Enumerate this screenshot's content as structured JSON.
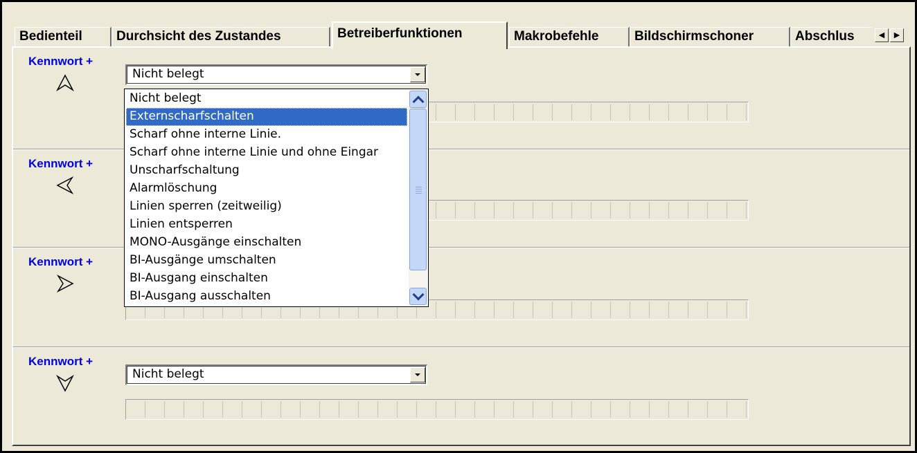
{
  "tabs": [
    {
      "label": "Bedienteil",
      "active": false
    },
    {
      "label": "Durchsicht des Zustandes",
      "active": false
    },
    {
      "label": "Betreiberfunktionen",
      "active": true
    },
    {
      "label": "Makrobefehle",
      "active": false
    },
    {
      "label": "Bildschirmschoner",
      "active": false
    },
    {
      "label": "Abschlus",
      "active": false
    }
  ],
  "tab_scroll": {
    "left_icon": "triangle-left-icon",
    "right_icon": "triangle-right-icon"
  },
  "groups": [
    {
      "label": "Kennwort +",
      "arrow_icon": "arrow-up-icon",
      "combo_value": "Nicht belegt"
    },
    {
      "label": "Kennwort +",
      "arrow_icon": "arrow-left-icon",
      "combo_value": ""
    },
    {
      "label": "Kennwort +",
      "arrow_icon": "arrow-right-icon",
      "combo_value": ""
    },
    {
      "label": "Kennwort +",
      "arrow_icon": "arrow-down-icon",
      "combo_value": "Nicht belegt"
    }
  ],
  "dropdown": {
    "selected_index": 1,
    "options": [
      "Nicht belegt",
      "Externscharfschalten",
      "Scharf ohne interne Linie.",
      "Scharf ohne interne Linie und ohne Eingar",
      "Unscharfschaltung",
      "Alarmlöschung",
      "Linien sperren (zeitweilig)",
      "Linien entsperren",
      "MONO-Ausgänge einschalten",
      "BI-Ausgänge umschalten",
      "BI-Ausgang einschalten",
      "BI-Ausgang ausschalten"
    ]
  },
  "colors": {
    "panel": "#ece9d8",
    "label_blue": "#0000e0",
    "selection": "#316ac5"
  }
}
